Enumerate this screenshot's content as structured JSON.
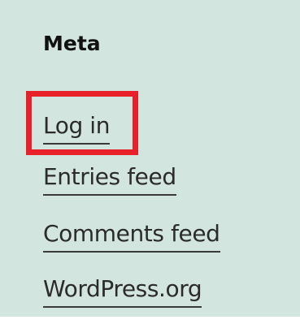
{
  "widget": {
    "title": "Meta",
    "links": [
      {
        "label": "Log in"
      },
      {
        "label": "Entries feed"
      },
      {
        "label": "Comments feed"
      },
      {
        "label": "WordPress.org"
      }
    ]
  },
  "colors": {
    "panel_background": "#d3e5df",
    "highlight_border": "#e8202a",
    "text": "#2b2b2b"
  }
}
